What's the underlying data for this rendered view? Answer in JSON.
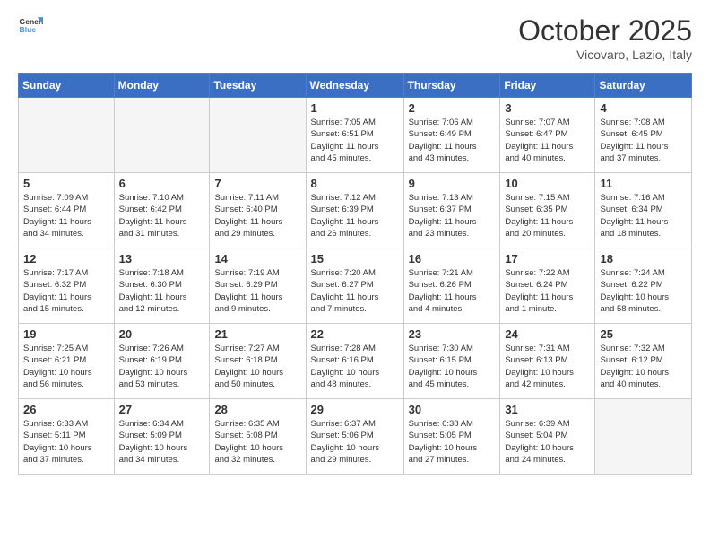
{
  "header": {
    "logo_general": "General",
    "logo_blue": "Blue",
    "month": "October 2025",
    "location": "Vicovaro, Lazio, Italy"
  },
  "days_of_week": [
    "Sunday",
    "Monday",
    "Tuesday",
    "Wednesday",
    "Thursday",
    "Friday",
    "Saturday"
  ],
  "weeks": [
    [
      {
        "day": "",
        "info": ""
      },
      {
        "day": "",
        "info": ""
      },
      {
        "day": "",
        "info": ""
      },
      {
        "day": "1",
        "info": "Sunrise: 7:05 AM\nSunset: 6:51 PM\nDaylight: 11 hours\nand 45 minutes."
      },
      {
        "day": "2",
        "info": "Sunrise: 7:06 AM\nSunset: 6:49 PM\nDaylight: 11 hours\nand 43 minutes."
      },
      {
        "day": "3",
        "info": "Sunrise: 7:07 AM\nSunset: 6:47 PM\nDaylight: 11 hours\nand 40 minutes."
      },
      {
        "day": "4",
        "info": "Sunrise: 7:08 AM\nSunset: 6:45 PM\nDaylight: 11 hours\nand 37 minutes."
      }
    ],
    [
      {
        "day": "5",
        "info": "Sunrise: 7:09 AM\nSunset: 6:44 PM\nDaylight: 11 hours\nand 34 minutes."
      },
      {
        "day": "6",
        "info": "Sunrise: 7:10 AM\nSunset: 6:42 PM\nDaylight: 11 hours\nand 31 minutes."
      },
      {
        "day": "7",
        "info": "Sunrise: 7:11 AM\nSunset: 6:40 PM\nDaylight: 11 hours\nand 29 minutes."
      },
      {
        "day": "8",
        "info": "Sunrise: 7:12 AM\nSunset: 6:39 PM\nDaylight: 11 hours\nand 26 minutes."
      },
      {
        "day": "9",
        "info": "Sunrise: 7:13 AM\nSunset: 6:37 PM\nDaylight: 11 hours\nand 23 minutes."
      },
      {
        "day": "10",
        "info": "Sunrise: 7:15 AM\nSunset: 6:35 PM\nDaylight: 11 hours\nand 20 minutes."
      },
      {
        "day": "11",
        "info": "Sunrise: 7:16 AM\nSunset: 6:34 PM\nDaylight: 11 hours\nand 18 minutes."
      }
    ],
    [
      {
        "day": "12",
        "info": "Sunrise: 7:17 AM\nSunset: 6:32 PM\nDaylight: 11 hours\nand 15 minutes."
      },
      {
        "day": "13",
        "info": "Sunrise: 7:18 AM\nSunset: 6:30 PM\nDaylight: 11 hours\nand 12 minutes."
      },
      {
        "day": "14",
        "info": "Sunrise: 7:19 AM\nSunset: 6:29 PM\nDaylight: 11 hours\nand 9 minutes."
      },
      {
        "day": "15",
        "info": "Sunrise: 7:20 AM\nSunset: 6:27 PM\nDaylight: 11 hours\nand 7 minutes."
      },
      {
        "day": "16",
        "info": "Sunrise: 7:21 AM\nSunset: 6:26 PM\nDaylight: 11 hours\nand 4 minutes."
      },
      {
        "day": "17",
        "info": "Sunrise: 7:22 AM\nSunset: 6:24 PM\nDaylight: 11 hours\nand 1 minute."
      },
      {
        "day": "18",
        "info": "Sunrise: 7:24 AM\nSunset: 6:22 PM\nDaylight: 10 hours\nand 58 minutes."
      }
    ],
    [
      {
        "day": "19",
        "info": "Sunrise: 7:25 AM\nSunset: 6:21 PM\nDaylight: 10 hours\nand 56 minutes."
      },
      {
        "day": "20",
        "info": "Sunrise: 7:26 AM\nSunset: 6:19 PM\nDaylight: 10 hours\nand 53 minutes."
      },
      {
        "day": "21",
        "info": "Sunrise: 7:27 AM\nSunset: 6:18 PM\nDaylight: 10 hours\nand 50 minutes."
      },
      {
        "day": "22",
        "info": "Sunrise: 7:28 AM\nSunset: 6:16 PM\nDaylight: 10 hours\nand 48 minutes."
      },
      {
        "day": "23",
        "info": "Sunrise: 7:30 AM\nSunset: 6:15 PM\nDaylight: 10 hours\nand 45 minutes."
      },
      {
        "day": "24",
        "info": "Sunrise: 7:31 AM\nSunset: 6:13 PM\nDaylight: 10 hours\nand 42 minutes."
      },
      {
        "day": "25",
        "info": "Sunrise: 7:32 AM\nSunset: 6:12 PM\nDaylight: 10 hours\nand 40 minutes."
      }
    ],
    [
      {
        "day": "26",
        "info": "Sunrise: 6:33 AM\nSunset: 5:11 PM\nDaylight: 10 hours\nand 37 minutes."
      },
      {
        "day": "27",
        "info": "Sunrise: 6:34 AM\nSunset: 5:09 PM\nDaylight: 10 hours\nand 34 minutes."
      },
      {
        "day": "28",
        "info": "Sunrise: 6:35 AM\nSunset: 5:08 PM\nDaylight: 10 hours\nand 32 minutes."
      },
      {
        "day": "29",
        "info": "Sunrise: 6:37 AM\nSunset: 5:06 PM\nDaylight: 10 hours\nand 29 minutes."
      },
      {
        "day": "30",
        "info": "Sunrise: 6:38 AM\nSunset: 5:05 PM\nDaylight: 10 hours\nand 27 minutes."
      },
      {
        "day": "31",
        "info": "Sunrise: 6:39 AM\nSunset: 5:04 PM\nDaylight: 10 hours\nand 24 minutes."
      },
      {
        "day": "",
        "info": ""
      }
    ]
  ]
}
